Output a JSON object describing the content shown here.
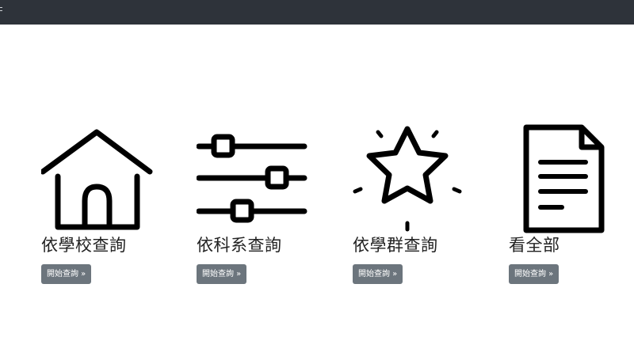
{
  "cards": [
    {
      "id": "school",
      "title": "依學校查詢",
      "button_label": "開始查詢 »",
      "icon": "house-icon"
    },
    {
      "id": "department",
      "title": "依科系查詢",
      "button_label": "開始查詢 »",
      "icon": "sliders-icon"
    },
    {
      "id": "group",
      "title": "依學群查詢",
      "button_label": "開始查詢 »",
      "icon": "star-icon"
    },
    {
      "id": "all",
      "title": "看全部",
      "button_label": "開始查詢 »",
      "icon": "document-icon"
    }
  ],
  "colors": {
    "topbar": "#2e333a",
    "button": "#6c757d",
    "icon_stroke": "#000000"
  }
}
